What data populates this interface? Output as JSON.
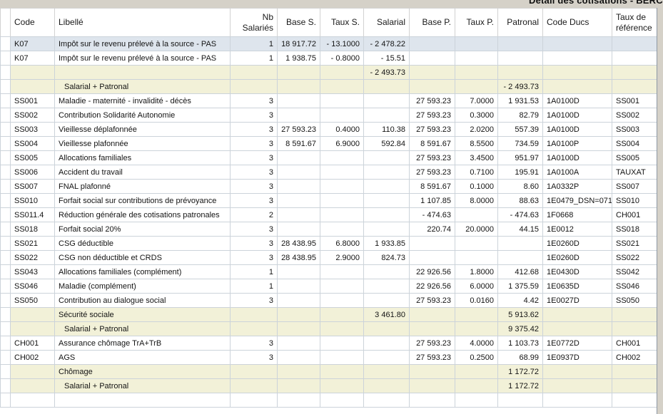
{
  "title": "Détail des cotisations - BERC",
  "colors": {
    "strip_bg": "#d5d1c8",
    "subtotal_bg": "#f2f1d8",
    "selected_bg": "#dee5ed",
    "grid_border": "#ccd3da"
  },
  "table": {
    "columns": [
      {
        "key": "code",
        "label": "Code",
        "align": "left"
      },
      {
        "key": "libelle",
        "label": "Libellé",
        "align": "left"
      },
      {
        "key": "nb",
        "label": "Nb Salariés",
        "align": "right"
      },
      {
        "key": "base_s",
        "label": "Base S.",
        "align": "right"
      },
      {
        "key": "taux_s",
        "label": "Taux S.",
        "align": "right"
      },
      {
        "key": "salarial",
        "label": "Salarial",
        "align": "right"
      },
      {
        "key": "base_p",
        "label": "Base P.",
        "align": "right"
      },
      {
        "key": "taux_p",
        "label": "Taux P.",
        "align": "right"
      },
      {
        "key": "patronal",
        "label": "Patronal",
        "align": "right"
      },
      {
        "key": "code_ducs",
        "label": "Code Ducs",
        "align": "left"
      },
      {
        "key": "taux_ref",
        "label": "Taux de référence",
        "align": "left"
      }
    ],
    "rows": [
      {
        "type": "selected",
        "cells": [
          "K07",
          "Impôt sur le revenu prélevé à la source - PAS",
          "1",
          "18 917.72",
          "- 13.1000",
          "- 2 478.22",
          "",
          "",
          "",
          "",
          ""
        ]
      },
      {
        "type": "data",
        "cells": [
          "K07",
          "Impôt sur le revenu prélevé à la source - PAS",
          "1",
          "1 938.75",
          "- 0.8000",
          "- 15.51",
          "",
          "",
          "",
          "",
          ""
        ]
      },
      {
        "type": "subtotal",
        "cells": [
          "",
          "",
          "",
          "",
          "",
          "- 2 493.73",
          "",
          "",
          "",
          "",
          ""
        ]
      },
      {
        "type": "subtotal",
        "indent": true,
        "cells": [
          "",
          "Salarial + Patronal",
          "",
          "",
          "",
          "",
          "",
          "",
          "- 2 493.73",
          "",
          ""
        ]
      },
      {
        "type": "data",
        "cells": [
          "SS001",
          "Maladie - maternité - invalidité - décès",
          "3",
          "",
          "",
          "",
          "27 593.23",
          "7.0000",
          "1 931.53",
          "1A0100D",
          "SS001"
        ]
      },
      {
        "type": "data",
        "cells": [
          "SS002",
          "Contribution Solidarité Autonomie",
          "3",
          "",
          "",
          "",
          "27 593.23",
          "0.3000",
          "82.79",
          "1A0100D",
          "SS002"
        ]
      },
      {
        "type": "data",
        "cells": [
          "SS003",
          "Vieillesse déplafonnée",
          "3",
          "27 593.23",
          "0.4000",
          "110.38",
          "27 593.23",
          "2.0200",
          "557.39",
          "1A0100D",
          "SS003"
        ]
      },
      {
        "type": "data",
        "cells": [
          "SS004",
          "Vieillesse plafonnée",
          "3",
          "8 591.67",
          "6.9000",
          "592.84",
          "8 591.67",
          "8.5500",
          "734.59",
          "1A0100P",
          "SS004"
        ]
      },
      {
        "type": "data",
        "cells": [
          "SS005",
          "Allocations familiales",
          "3",
          "",
          "",
          "",
          "27 593.23",
          "3.4500",
          "951.97",
          "1A0100D",
          "SS005"
        ]
      },
      {
        "type": "data",
        "cells": [
          "SS006",
          "Accident du travail",
          "3",
          "",
          "",
          "",
          "27 593.23",
          "0.7100",
          "195.91",
          "1A0100A",
          "TAUXAT"
        ]
      },
      {
        "type": "data",
        "cells": [
          "SS007",
          "FNAL plafonné",
          "3",
          "",
          "",
          "",
          "8 591.67",
          "0.1000",
          "8.60",
          "1A0332P",
          "SS007"
        ]
      },
      {
        "type": "data",
        "cells": [
          "SS010",
          "Forfait social sur contributions de prévoyance",
          "3",
          "",
          "",
          "",
          "1 107.85",
          "8.0000",
          "88.63",
          "1E0479_DSN=071",
          "SS010"
        ]
      },
      {
        "type": "data",
        "cells": [
          "SS011.4",
          "Réduction générale des cotisations patronales",
          "2",
          "",
          "",
          "",
          "- 474.63",
          "",
          "- 474.63",
          "1F0668",
          "CH001"
        ]
      },
      {
        "type": "data",
        "cells": [
          "SS018",
          "Forfait social 20%",
          "3",
          "",
          "",
          "",
          "220.74",
          "20.0000",
          "44.15",
          "1E0012",
          "SS018"
        ]
      },
      {
        "type": "data",
        "cells": [
          "SS021",
          "CSG déductible",
          "3",
          "28 438.95",
          "6.8000",
          "1 933.85",
          "",
          "",
          "",
          "1E0260D",
          "SS021"
        ]
      },
      {
        "type": "data",
        "cells": [
          "SS022",
          "CSG non déductible et CRDS",
          "3",
          "28 438.95",
          "2.9000",
          "824.73",
          "",
          "",
          "",
          "1E0260D",
          "SS022"
        ]
      },
      {
        "type": "data",
        "cells": [
          "SS043",
          "Allocations familiales (complément)",
          "1",
          "",
          "",
          "",
          "22 926.56",
          "1.8000",
          "412.68",
          "1E0430D",
          "SS042"
        ]
      },
      {
        "type": "data",
        "cells": [
          "SS046",
          "Maladie (complément)",
          "1",
          "",
          "",
          "",
          "22 926.56",
          "6.0000",
          "1 375.59",
          "1E0635D",
          "SS046"
        ]
      },
      {
        "type": "data",
        "cells": [
          "SS050",
          "Contribution au dialogue social",
          "3",
          "",
          "",
          "",
          "27 593.23",
          "0.0160",
          "4.42",
          "1E0027D",
          "SS050"
        ]
      },
      {
        "type": "subtotal",
        "cells": [
          "",
          "Sécurité sociale",
          "",
          "",
          "",
          "3 461.80",
          "",
          "",
          "5 913.62",
          "",
          ""
        ]
      },
      {
        "type": "subtotal",
        "indent": true,
        "cells": [
          "",
          "Salarial + Patronal",
          "",
          "",
          "",
          "",
          "",
          "",
          "9 375.42",
          "",
          ""
        ]
      },
      {
        "type": "data",
        "cells": [
          "CH001",
          "Assurance chômage TrA+TrB",
          "3",
          "",
          "",
          "",
          "27 593.23",
          "4.0000",
          "1 103.73",
          "1E0772D",
          "CH001"
        ]
      },
      {
        "type": "data",
        "cells": [
          "CH002",
          "AGS",
          "3",
          "",
          "",
          "",
          "27 593.23",
          "0.2500",
          "68.99",
          "1E0937D",
          "CH002"
        ]
      },
      {
        "type": "subtotal",
        "cells": [
          "",
          "Chômage",
          "",
          "",
          "",
          "",
          "",
          "",
          "1 172.72",
          "",
          ""
        ]
      },
      {
        "type": "subtotal",
        "indent": true,
        "cells": [
          "",
          "Salarial + Patronal",
          "",
          "",
          "",
          "",
          "",
          "",
          "1 172.72",
          "",
          ""
        ]
      },
      {
        "type": "data",
        "cells": [
          "",
          "",
          "",
          "",
          "",
          "",
          "",
          "",
          "",
          "",
          ""
        ]
      }
    ]
  }
}
